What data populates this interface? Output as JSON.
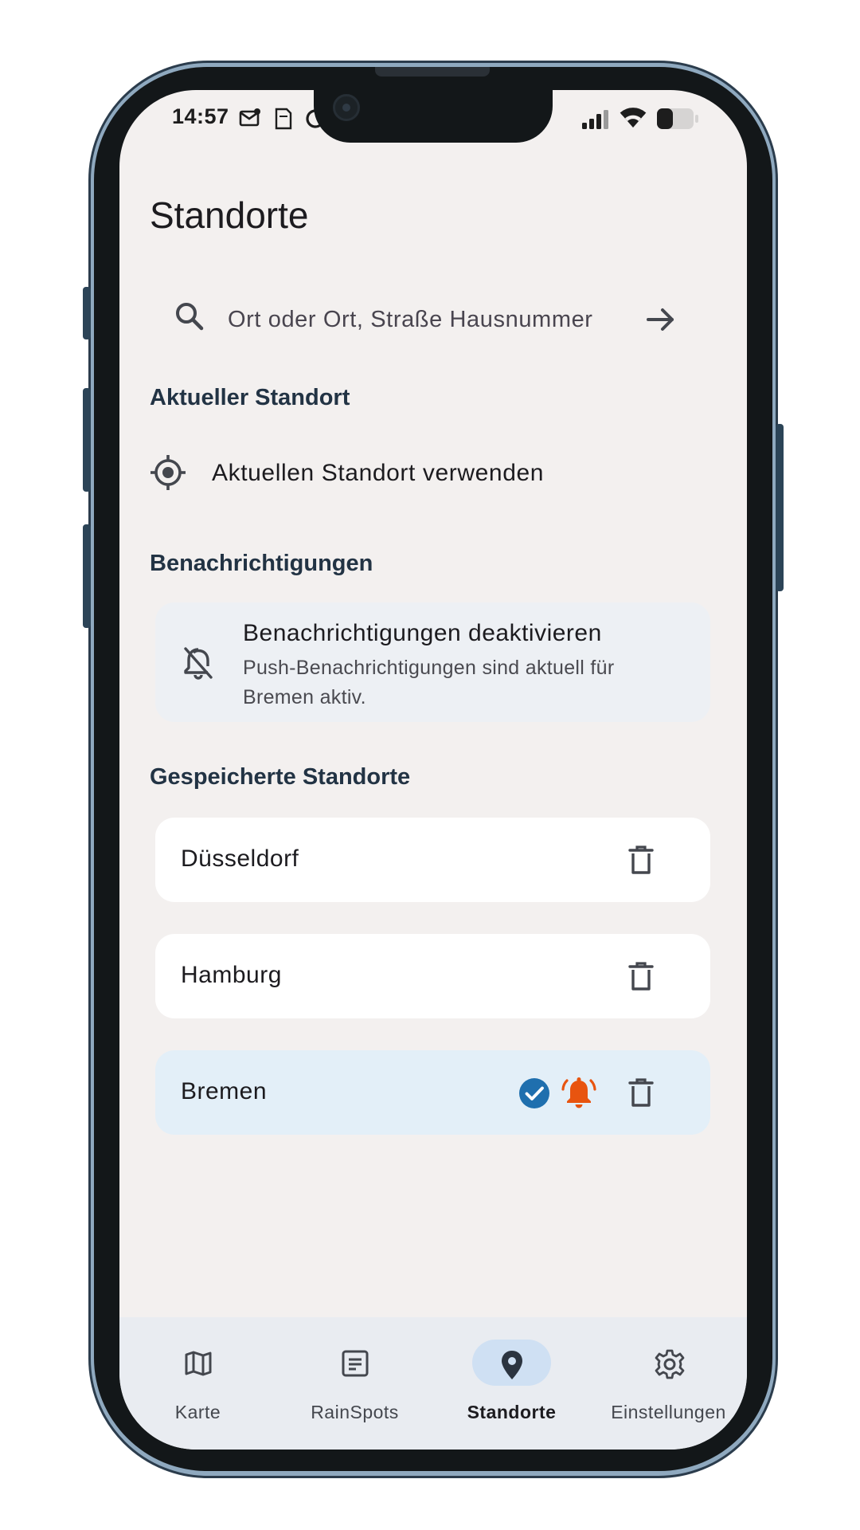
{
  "status_bar": {
    "time": "14:57",
    "icons": [
      "mail-icon",
      "sim-card-icon",
      "data-saver-icon",
      "signal-icon",
      "wifi-icon",
      "battery-icon"
    ]
  },
  "header": {
    "title": "Standorte"
  },
  "search": {
    "placeholder": "Ort oder Ort, Straße Hausnummer",
    "value": "",
    "icon": "search-icon",
    "submit_icon": "arrow-right-icon"
  },
  "current_location": {
    "section_title": "Aktueller Standort",
    "action_label": "Aktuellen Standort verwenden",
    "icon": "crosshair-icon"
  },
  "notifications": {
    "section_title": "Benachrichtigungen",
    "card_title": "Benachrichtigungen deaktivieren",
    "card_subtitle": "Push-Benachrichtigungen sind aktuell für Bremen aktiv.",
    "icon": "bell-off-icon"
  },
  "saved_locations": {
    "section_title": "Gespeicherte Standorte",
    "items": [
      {
        "name": "Düsseldorf",
        "selected": false,
        "notifications": false
      },
      {
        "name": "Hamburg",
        "selected": false,
        "notifications": false
      },
      {
        "name": "Bremen",
        "selected": true,
        "notifications": true
      }
    ]
  },
  "bottom_nav": {
    "items": [
      {
        "label": "Karte",
        "icon": "map-icon",
        "selected": false
      },
      {
        "label": "RainSpots",
        "icon": "notes-icon",
        "selected": false
      },
      {
        "label": "Standorte",
        "icon": "location-pin-icon",
        "selected": true
      },
      {
        "label": "Einstellungen",
        "icon": "gear-icon",
        "selected": false
      }
    ]
  },
  "colors": {
    "background": "#f3f0ef",
    "section_title": "#223344",
    "active_card": "#e3eff8",
    "notification_card": "#edf0f4",
    "check_blue": "#1f6fae",
    "bell_orange": "#e8540f",
    "nav_bar": "#e9ecf1",
    "nav_selected_pill": "#cfe0f3"
  }
}
